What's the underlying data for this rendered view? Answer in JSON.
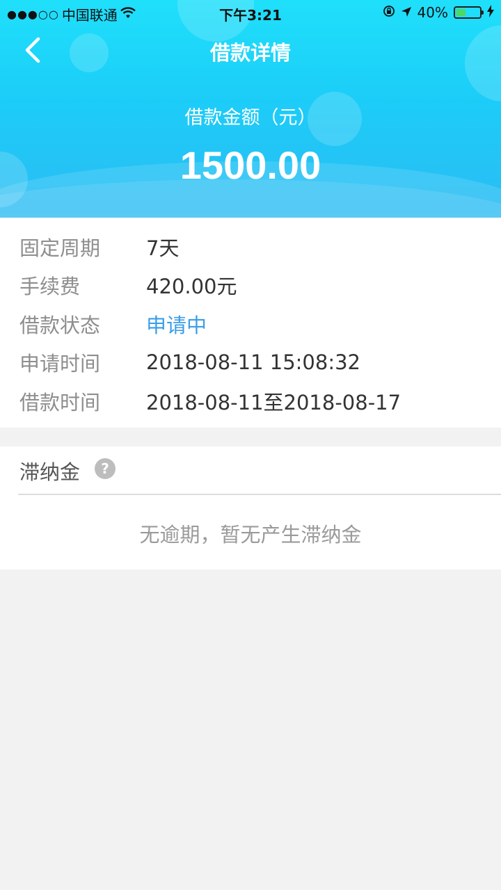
{
  "status_bar": {
    "signal": "●●●○○",
    "carrier": "中国联通",
    "time": "下午3:21",
    "battery_percent": "40%",
    "battery_level": 0.4
  },
  "nav": {
    "title": "借款详情"
  },
  "summary": {
    "amount_label": "借款金额（元）",
    "amount": "1500.00"
  },
  "details": [
    {
      "label": "固定周期",
      "value": "7天"
    },
    {
      "label": "手续费",
      "value": "420.00元"
    },
    {
      "label": "借款状态",
      "value": "申请中"
    },
    {
      "label": "申请时间",
      "value": "2018-08-11 15:08:32"
    },
    {
      "label": "借款时间",
      "value": "2018-08-11至2018-08-17"
    }
  ],
  "late_fee": {
    "title": "滞纳金",
    "help": "?",
    "note": "无逾期，暂无产生滞纳金"
  },
  "colors": {
    "header_top": "#1fe0fb",
    "header_bottom": "#2bbcf3",
    "status_blue": "#3a9ee8",
    "page_bg": "#f2f2f2"
  }
}
